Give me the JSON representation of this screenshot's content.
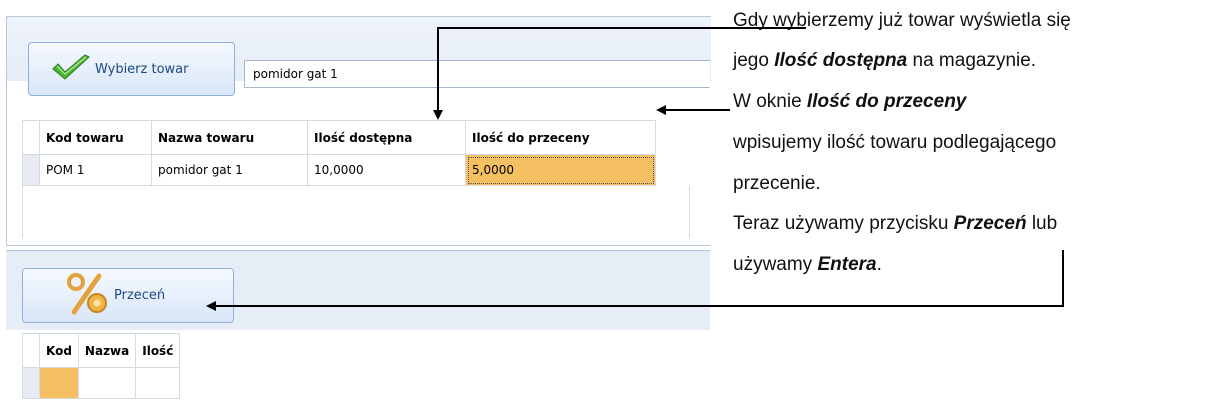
{
  "top_panel": {
    "select_button_label": "Wybierz towar",
    "search_value": "pomidor gat 1",
    "columns": [
      "Kod towaru",
      "Nazwa towaru",
      "Ilość dostępna",
      "Ilość do przeceny"
    ],
    "rows": [
      {
        "kod": "POM 1",
        "nazwa": "pomidor gat 1",
        "ilosc_dostepna": "10,0000",
        "ilosc_do_przeceny": "5,0000"
      }
    ]
  },
  "bottom_panel": {
    "reprice_button_label": "Przeceń",
    "columns": [
      "Kod",
      "Nazwa",
      "Ilość"
    ]
  },
  "annotation": {
    "line1": "Gdy wybierzemy już towar wyświetla się",
    "line2_pre": "jego ",
    "line2_bold": "Ilość dostępna",
    "line2_post": " na magazynie.",
    "line3_pre": "W oknie ",
    "line3_bold": "Ilość do przeceny",
    "line4": "wpisujemy ilość towaru podlegającego",
    "line5": "przecenie.",
    "line6_pre": "Teraz używamy przycisku ",
    "line6_bold": "Przeceń",
    "line6_post": " lub",
    "line7_pre": "używamy ",
    "line7_bold": "Entera",
    "line7_post": "."
  },
  "icons": {
    "select_button_icon": "checkmark-icon",
    "reprice_button_icon": "percent-icon"
  },
  "colors": {
    "highlight_cell": "#f4c061",
    "button_text": "#1c4a84",
    "checkmark": "#3fae2a",
    "percent": "#e3a23a"
  }
}
